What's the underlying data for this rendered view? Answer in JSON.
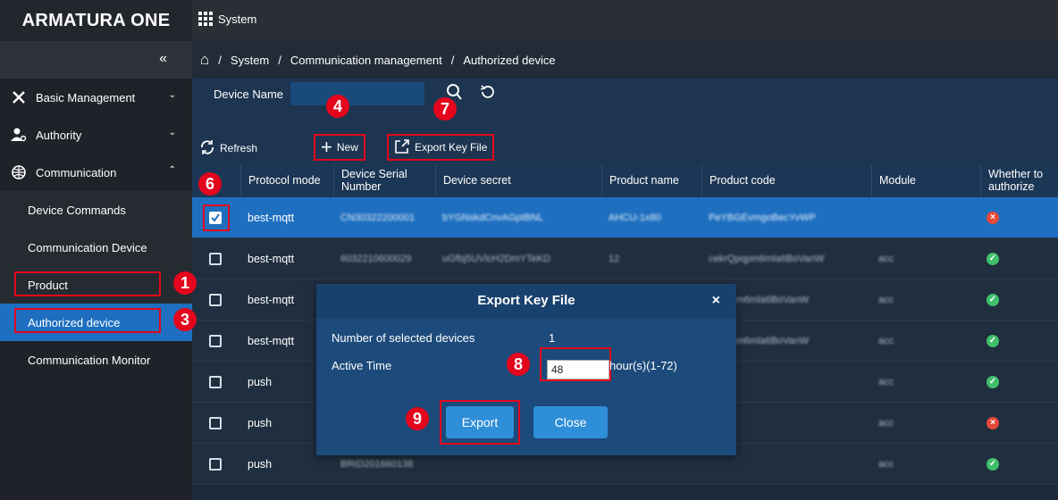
{
  "brand": {
    "name": "ARMATURA ONE"
  },
  "topbar": {
    "system_label": "System"
  },
  "sidebar": {
    "collapse": "«",
    "groups": [
      {
        "label": "Basic Management",
        "arrow": "⌄"
      },
      {
        "label": "Authority",
        "arrow": "⌄"
      },
      {
        "label": "Communication",
        "arrow": "⌃"
      }
    ],
    "items": [
      {
        "label": "Device Commands"
      },
      {
        "label": "Communication Device"
      },
      {
        "label": "Product"
      },
      {
        "label": "Authorized device"
      },
      {
        "label": "Communication Monitor"
      }
    ]
  },
  "breadcrumb": {
    "home": "⌂",
    "sep": "/",
    "items": [
      "System",
      "Communication management",
      "Authorized device"
    ]
  },
  "filter": {
    "device_name_label": "Device Name",
    "device_name_value": ""
  },
  "toolbar": {
    "refresh": "Refresh",
    "new": "New",
    "export": "Export Key File"
  },
  "table": {
    "headers": [
      "Protocol mode",
      "Device Serial Number",
      "Device secret",
      "Product name",
      "Product code",
      "Module",
      "Whether to authorize"
    ],
    "rows": [
      {
        "protocol": "best-mqtt",
        "serial": "CN30322200001",
        "secret": "bYGNskdCnvAGptBNL",
        "product_name": "AHCU-1x80",
        "product_code": "PeYBGEvmgoBecYvWP",
        "module": "",
        "authorized": false,
        "selected": true
      },
      {
        "protocol": "best-mqtt",
        "serial": "6032210600029",
        "secret": "uGfbj5UVlcH2DmYTeKD",
        "product_name": "12",
        "product_code": "cekrQpqpm6mla6BoVanW",
        "module": "acc",
        "authorized": true,
        "selected": false
      },
      {
        "protocol": "best-mqtt",
        "serial": "",
        "secret": "",
        "product_name": "",
        "product_code": "rQpqpm6mla6BoVanW",
        "module": "acc",
        "authorized": true,
        "selected": false
      },
      {
        "protocol": "best-mqtt",
        "serial": "",
        "secret": "",
        "product_name": "",
        "product_code": "rQpqpm6mla6BoVanW",
        "module": "acc",
        "authorized": true,
        "selected": false
      },
      {
        "protocol": "push",
        "serial": "",
        "secret": "",
        "product_name": "",
        "product_code": "",
        "module": "acc",
        "authorized": true,
        "selected": false
      },
      {
        "protocol": "push",
        "serial": "",
        "secret": "",
        "product_name": "",
        "product_code": "",
        "module": "acc",
        "authorized": false,
        "selected": false
      },
      {
        "protocol": "push",
        "serial": "BRID201660138",
        "secret": "",
        "product_name": "",
        "product_code": "",
        "module": "acc",
        "authorized": true,
        "selected": false
      }
    ]
  },
  "dialog": {
    "title": "Export Key File",
    "close": "×",
    "selected_label": "Number of selected devices",
    "selected_value": "1",
    "active_label": "Active Time",
    "active_value": "48",
    "active_unit": "hour(s)(1-72)",
    "export_btn": "Export",
    "close_btn": "Close"
  },
  "badges": [
    "1",
    "3",
    "4",
    "6",
    "7",
    "8",
    "9"
  ],
  "colors": {
    "accent": "#1e6fc0",
    "highlight": "#e3061c",
    "ok": "#3fbf6a",
    "error": "#e6493a"
  }
}
